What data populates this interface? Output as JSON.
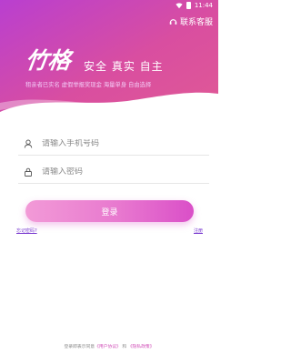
{
  "status_bar": {
    "time": "11:44"
  },
  "header": {
    "service_label": "联系客服",
    "logo_text": "竹格",
    "slogan": "安全 真实 自主",
    "tagline": "租亲者已实名 虚假举报奖现金 海量单身 自由选择"
  },
  "form": {
    "phone_placeholder": "请输入手机号码",
    "password_placeholder": "请输入密码",
    "login_label": "登录",
    "forgot_label": "忘记密码?",
    "register_label": "注册"
  },
  "agreement": {
    "prefix": "登录即表示同意",
    "user_agreement": "《用户协议》",
    "joiner": "和",
    "privacy_policy": "《隐私政策》"
  },
  "colors": {
    "hero_start": "#b93fd0",
    "hero_end": "#e05a95",
    "button_start": "#f29ad7",
    "button_end": "#da4fc8",
    "link": "#7a3bd0"
  },
  "icons": {
    "wifi": "wifi-icon",
    "battery": "battery-icon",
    "service": "headset-icon",
    "phone": "user-icon",
    "password": "lock-icon"
  }
}
